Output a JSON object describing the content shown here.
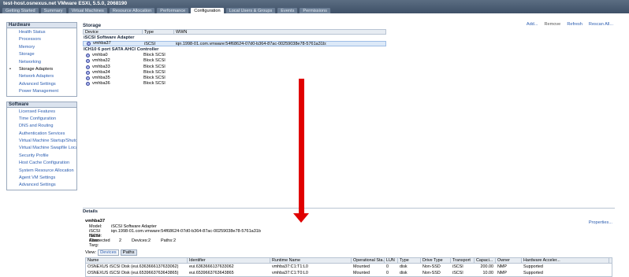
{
  "window": {
    "title": "test-host.osnexus.net VMware ESXi, 5.5.0, 2068190"
  },
  "tabs": [
    "Getting Started",
    "Summary",
    "Virtual Machines",
    "Resource Allocation",
    "Performance",
    "Configuration",
    "Local Users & Groups",
    "Events",
    "Permissions"
  ],
  "active_tab": "Configuration",
  "hardware": {
    "header": "Hardware",
    "items": [
      "Health Status",
      "Processors",
      "Memory",
      "Storage",
      "Networking",
      "Storage Adapters",
      "Network Adapters",
      "Advanced Settings",
      "Power Management"
    ],
    "active": "Storage Adapters"
  },
  "software": {
    "header": "Software",
    "items": [
      "Licensed Features",
      "Time Configuration",
      "DNS and Routing",
      "Authentication Services",
      "Virtual Machine Startup/Shutd",
      "Virtual Machine Swapfile Locati",
      "Security Profile",
      "Host Cache Configuration",
      "System Resource Allocation",
      "Agent VM Settings",
      "Advanced Settings"
    ]
  },
  "storage": {
    "header": "Storage",
    "actions": {
      "add": "Add...",
      "remove": "Remove",
      "refresh": "Refresh",
      "rescan": "Rescan All..."
    },
    "columns": [
      "Device",
      "Type",
      "WWN"
    ],
    "groups": [
      {
        "name": "iSCSI Software Adapter",
        "rows": [
          {
            "device": "vmhba37",
            "type": "iSCSI",
            "wwn": "iqn.1998-01.com.vmware:54f68624-07d0-b364-87ac-00259038e78-5761a31b:",
            "selected": true
          }
        ]
      },
      {
        "name": "ICH10 6 port SATA AHCI Controller",
        "rows": [
          {
            "device": "vmhba0",
            "type": "Block SCSI",
            "wwn": ""
          },
          {
            "device": "vmhba32",
            "type": "Block SCSI",
            "wwn": ""
          },
          {
            "device": "vmhba33",
            "type": "Block SCSI",
            "wwn": ""
          },
          {
            "device": "vmhba34",
            "type": "Block SCSI",
            "wwn": ""
          },
          {
            "device": "vmhba35",
            "type": "Block SCSI",
            "wwn": ""
          },
          {
            "device": "vmhba36",
            "type": "Block SCSI",
            "wwn": ""
          }
        ]
      }
    ]
  },
  "details": {
    "header": "Details",
    "properties_link": "Properties...",
    "name": "vmhba37",
    "model_label": "Model:",
    "model": "iSCSI Software Adapter",
    "iscsi_name_label": "iSCSI Name:",
    "iscsi_name": "iqn.1998-01.com.vmware:54f68624-07d0-b364-87ac-00259038e78-5761a31b",
    "iscsi_alias_label": "iSCSI Alias:",
    "targets_label": "Connected Targ:",
    "targets": "2",
    "devices_label": "Devices:",
    "devices": "2",
    "paths_label": "Paths:",
    "paths": "2",
    "view_label": "View:",
    "view_buttons": [
      "Devices",
      "Paths"
    ],
    "view_active": "Paths",
    "columns": [
      "Name",
      "Identifier",
      "Runtime Name",
      "Operational Sta...",
      "LUN",
      "Type",
      "Drive Type",
      "Transport",
      "Capaci...",
      "Owner",
      "Hardware Acceler..."
    ],
    "rows": [
      [
        "OSNEXUS iSCSI Disk (eui.6363666137633062)",
        "eui.6363666137633062",
        "vmhba37:C1:T1:L0",
        "Mounted",
        "0",
        "disk",
        "Non-SSD",
        "iSCSI",
        "200.00",
        "NMP",
        "Supported"
      ],
      [
        "OSNEXUS iSCSI Disk (eui.6539663763643865)",
        "eui.6539663763643865",
        "vmhba37:C1:T0:L0",
        "Mounted",
        "0",
        "disk",
        "Non-SSD",
        "iSCSI",
        "10.00",
        "NMP",
        "Supported"
      ]
    ]
  },
  "colors": {
    "titlebar": "#3d4f66",
    "link": "#2b5db0",
    "arrow": "#e00000",
    "selection": "#dce9f8"
  }
}
